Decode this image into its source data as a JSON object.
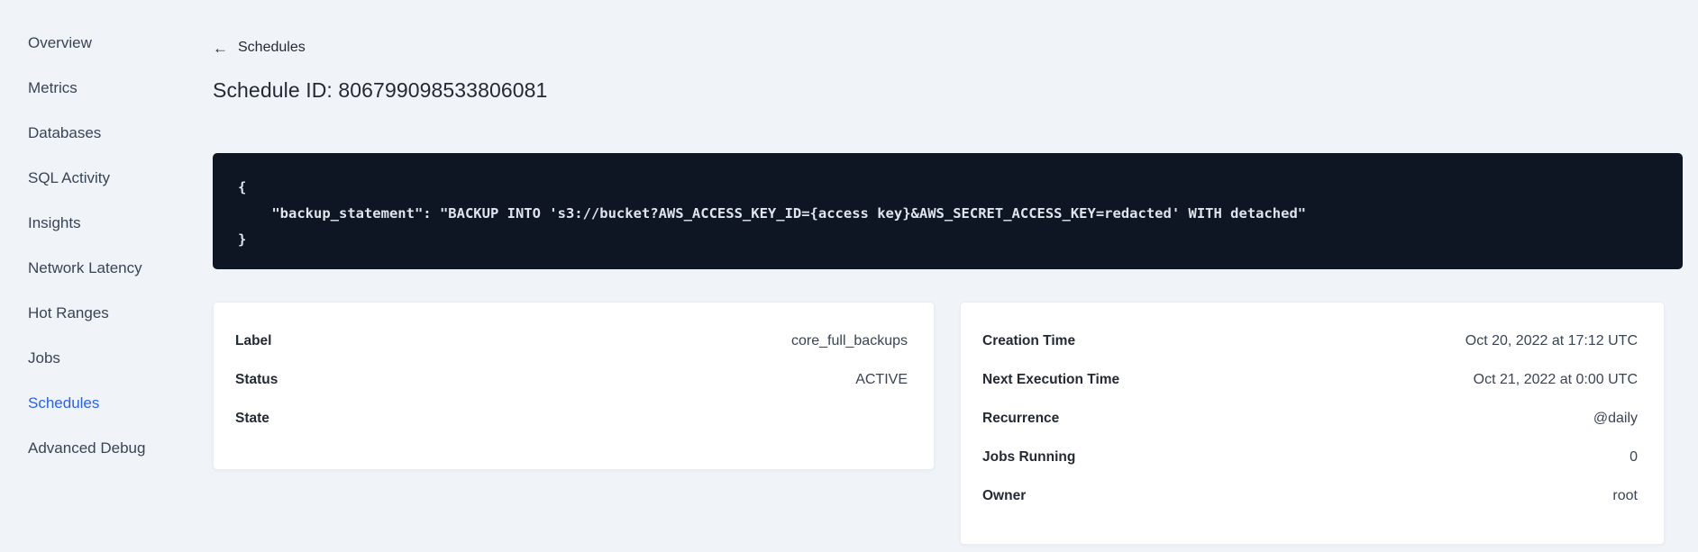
{
  "sidebar": {
    "items": [
      {
        "label": "Overview",
        "active": false
      },
      {
        "label": "Metrics",
        "active": false
      },
      {
        "label": "Databases",
        "active": false
      },
      {
        "label": "SQL Activity",
        "active": false
      },
      {
        "label": "Insights",
        "active": false
      },
      {
        "label": "Network Latency",
        "active": false
      },
      {
        "label": "Hot Ranges",
        "active": false
      },
      {
        "label": "Jobs",
        "active": false
      },
      {
        "label": "Schedules",
        "active": true
      },
      {
        "label": "Advanced Debug",
        "active": false
      }
    ]
  },
  "header": {
    "back_icon": "←",
    "back_link": "Schedules",
    "title": "Schedule ID: 806799098533806081"
  },
  "code_block": {
    "lines": [
      "{",
      "    \"backup_statement\": \"BACKUP INTO 's3://bucket?AWS_ACCESS_KEY_ID={access key}&AWS_SECRET_ACCESS_KEY=redacted' WITH detached\"",
      "}"
    ]
  },
  "details_card": {
    "rows": [
      {
        "label": "Label",
        "value": "core_full_backups"
      },
      {
        "label": "Status",
        "value": "ACTIVE"
      },
      {
        "label": "State",
        "value": ""
      }
    ]
  },
  "schedule_card": {
    "rows": [
      {
        "label": "Creation Time",
        "value": "Oct 20, 2022 at 17:12 UTC"
      },
      {
        "label": "Next Execution Time",
        "value": "Oct 21, 2022 at 0:00 UTC"
      },
      {
        "label": "Recurrence",
        "value": "@daily"
      },
      {
        "label": "Jobs Running",
        "value": "0"
      },
      {
        "label": "Owner",
        "value": "root"
      }
    ]
  },
  "colors": {
    "accent_blue": "#2962f0",
    "code_bg": "#0e1624",
    "page_bg": "#f0f4f8",
    "card_bg": "#ffffff"
  }
}
